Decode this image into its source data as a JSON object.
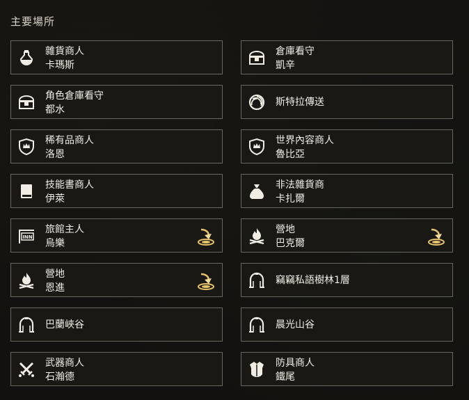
{
  "section_title": "主要場所",
  "cards": [
    {
      "icon": "potion-icon",
      "line1": "雜貨商人",
      "line2": "卡瑪斯",
      "teleport": false
    },
    {
      "icon": "chest-icon",
      "line1": "倉庫看守",
      "line2": "凱辛",
      "teleport": false
    },
    {
      "icon": "chest-icon",
      "line1": "角色倉庫看守",
      "line2": "都水",
      "teleport": false
    },
    {
      "icon": "portal-swirl-icon",
      "line1": "斯特拉傳送",
      "line2": "",
      "teleport": false
    },
    {
      "icon": "shield-crown-icon",
      "line1": "稀有品商人",
      "line2": "洛恩",
      "teleport": false
    },
    {
      "icon": "shield-crown-icon",
      "line1": "世界內容商人",
      "line2": "魯比亞",
      "teleport": false
    },
    {
      "icon": "book-icon",
      "line1": "技能書商人",
      "line2": "伊萊",
      "teleport": false
    },
    {
      "icon": "money-bag-icon",
      "line1": "非法雜貨商",
      "line2": "卡扎爾",
      "teleport": false
    },
    {
      "icon": "inn-sign-icon",
      "line1": "旅館主人",
      "line2": "烏樂",
      "teleport": true
    },
    {
      "icon": "campfire-icon",
      "line1": "營地",
      "line2": "巴克爾",
      "teleport": true
    },
    {
      "icon": "campfire-icon",
      "line1": "營地",
      "line2": "恩進",
      "teleport": true
    },
    {
      "icon": "gate-icon",
      "line1": "竊竊私語樹林1層",
      "line2": "",
      "teleport": false
    },
    {
      "icon": "gate-icon",
      "line1": "巴蘭峽谷",
      "line2": "",
      "teleport": false
    },
    {
      "icon": "gate-icon",
      "line1": "晨光山谷",
      "line2": "",
      "teleport": false
    },
    {
      "icon": "crossed-swords-icon",
      "line1": "武器商人",
      "line2": "石瀚德",
      "teleport": false
    },
    {
      "icon": "armor-icon",
      "line1": "防具商人",
      "line2": "鐵尾",
      "teleport": false
    }
  ]
}
